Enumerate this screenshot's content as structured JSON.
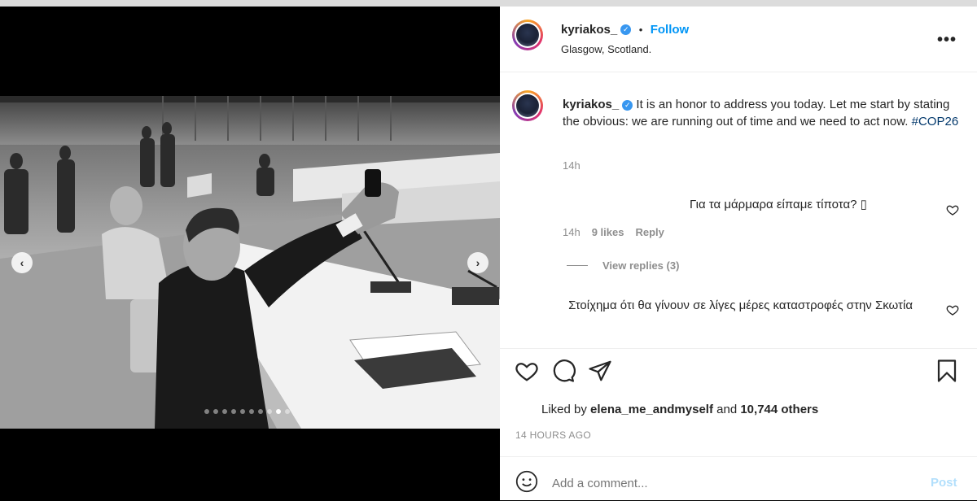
{
  "post": {
    "username": "kyriakos_",
    "follow_label": "Follow",
    "location": "Glasgow, Scotland.",
    "caption": "It is an honor to address you today. Let me start by stating the obvious: we are running out of time and we need to act now.",
    "hashtag": "#COP26",
    "caption_time": "14h",
    "carousel": {
      "total": 10,
      "active_index": 8
    }
  },
  "comments": [
    {
      "text": "Για τα μάρμαρα είπαμε τίποτα? ",
      "trailing_glyph": "▯",
      "time": "14h",
      "likes": "9 likes",
      "reply_label": "Reply",
      "view_replies": "View replies (3)"
    },
    {
      "text": "Στοίχημα ότι θα γίνουν σε λίγες μέρες καταστροφές στην Σκωτία"
    }
  ],
  "likes": {
    "prefix": "Liked by",
    "user": "elena_me_andmyself",
    "middle": "and",
    "count": "10,744 others"
  },
  "posted_ago": "14 HOURS AGO",
  "comment_box": {
    "placeholder": "Add a comment...",
    "post_label": "Post"
  },
  "colors": {
    "accent_blue": "#0095f6",
    "verified_blue": "#3897f0",
    "hashtag_blue": "#00376b",
    "muted_gray": "#8e8e8e",
    "post_disabled": "#b2dffc"
  },
  "icons": [
    "verified-badge-icon",
    "more-options-icon",
    "heart-icon",
    "comment-icon",
    "share-icon",
    "bookmark-icon",
    "emoji-icon",
    "chevron-left-icon",
    "chevron-right-icon"
  ]
}
